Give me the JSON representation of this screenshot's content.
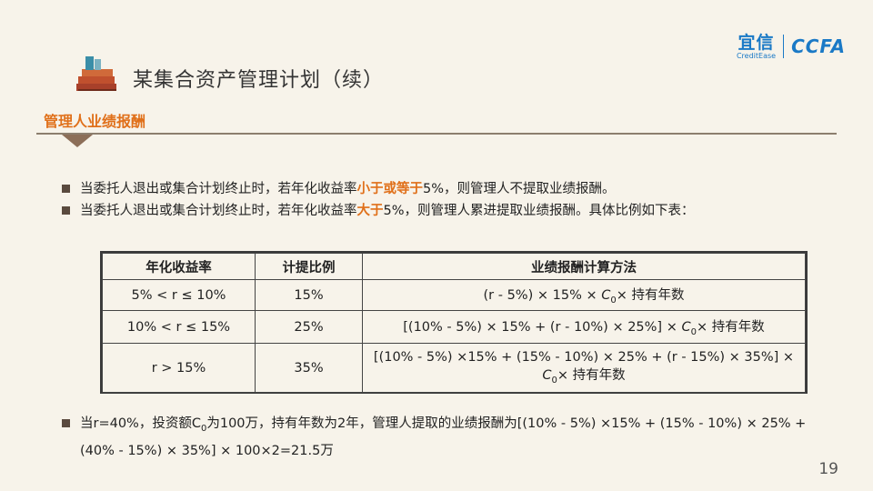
{
  "header": {
    "title": "某集合资产管理计划（续）",
    "logo_cn": "宜信",
    "logo_en": "CreditEase",
    "logo_ccfa": "CCFA"
  },
  "section_title": "管理人业绩报酬",
  "bullets": [
    {
      "pre": "当委托人退出或集合计划终止时，若年化收益率",
      "highlight": "小于或等于",
      "post": "5%，则管理人不提取业绩报酬。"
    },
    {
      "pre": "当委托人退出或集合计划终止时，若年化收益率",
      "highlight": "大于",
      "post": "5%，则管理人累进提取业绩报酬。具体比例如下表："
    }
  ],
  "table": {
    "headers": [
      "年化收益率",
      "计提比例",
      "业绩报酬计算方法"
    ],
    "rows": [
      {
        "range": "5% < r ≤ 10%",
        "ratio": "15%",
        "method_pre": "(r - 5%) × 15% × ",
        "c": "C",
        "sub": "0",
        "method_post": "× 持有年数"
      },
      {
        "range": "10% < r ≤ 15%",
        "ratio": "25%",
        "method_pre": "[(10% - 5%) × 15% + (r - 10%) × 25%] × ",
        "c": "C",
        "sub": "0",
        "method_post": "× 持有年数"
      },
      {
        "range": "r > 15%",
        "ratio": "35%",
        "method_pre": "[(10% - 5%) ×15% + (15% - 10%) × 25% + (r - 15%) × 35%] × ",
        "c": "C",
        "sub": "0",
        "method_post": "× 持有年数"
      }
    ]
  },
  "example": {
    "pre": "当r=40%，投资额C",
    "sub": "0",
    "post": "为100万，持有年数为2年，管理人提取的业绩报酬为[(10% - 5%) ×15% + (15% - 10%) × 25% + (40% - 15%) × 35%] × 100×2=21.5万"
  },
  "page_number": "19"
}
